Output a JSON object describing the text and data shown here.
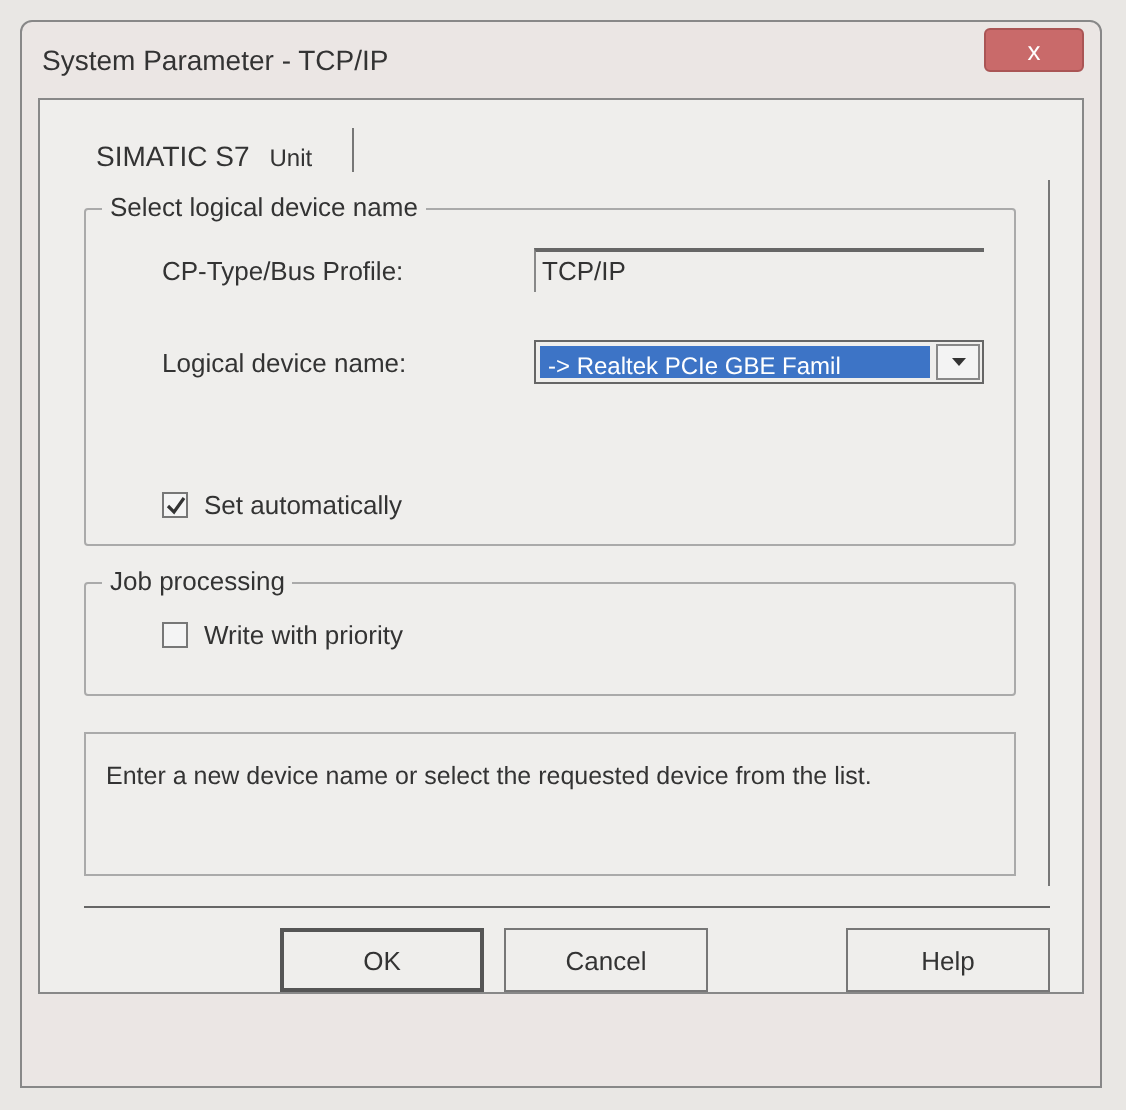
{
  "window": {
    "title": "System Parameter - TCP/IP",
    "close": "x"
  },
  "tabs": [
    {
      "label": "SIMATIC S7",
      "selected": true
    },
    {
      "label": "Unit",
      "selected": false
    }
  ],
  "device_group": {
    "title": "Select logical device name",
    "cp_type_label": "CP-Type/Bus Profile:",
    "cp_type_value": "TCP/IP",
    "device_label": "Logical device name:",
    "device_value": "-> Realtek PCIe GBE Famil",
    "set_automatically": {
      "label": "Set automatically",
      "checked": true
    }
  },
  "job_group": {
    "title": "Job processing",
    "write_priority": {
      "label": "Write with priority",
      "checked": false
    }
  },
  "message": "Enter a new device name or select the requested device from the list.",
  "buttons": [
    {
      "label": "OK",
      "kind": "default"
    },
    {
      "label": "Cancel",
      "kind": "normal"
    },
    {
      "label": "Help",
      "kind": "normal"
    }
  ]
}
